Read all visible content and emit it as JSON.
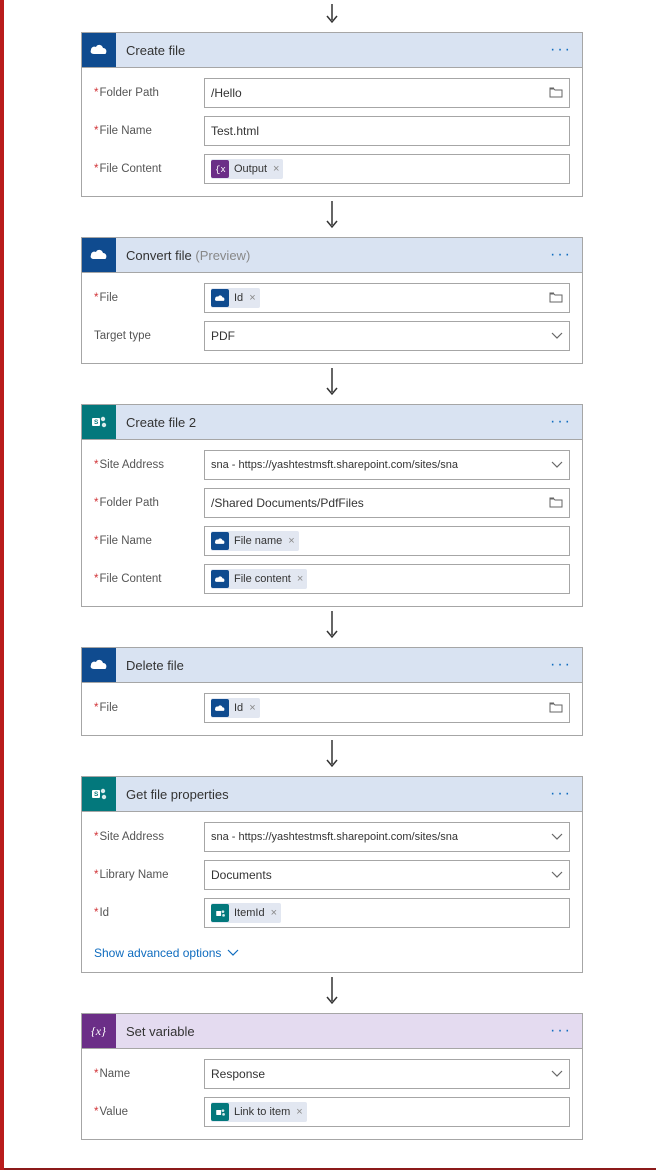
{
  "steps": [
    {
      "title": "Create file",
      "fields": {
        "folderPath": {
          "label": "Folder Path",
          "value": "/Hello"
        },
        "fileName": {
          "label": "File Name",
          "value": "Test.html"
        },
        "fileContent": {
          "label": "File Content",
          "token": "Output"
        }
      }
    },
    {
      "title": "Convert file",
      "preview": "(Preview)",
      "fields": {
        "file": {
          "label": "File",
          "token": "Id"
        },
        "targetType": {
          "label": "Target type",
          "value": "PDF"
        }
      }
    },
    {
      "title": "Create file 2",
      "fields": {
        "siteAddress": {
          "label": "Site Address",
          "value": "sna - https://yashtestmsft.sharepoint.com/sites/sna"
        },
        "folderPath": {
          "label": "Folder Path",
          "value": "/Shared Documents/PdfFiles"
        },
        "fileName": {
          "label": "File Name",
          "token": "File name"
        },
        "fileContent": {
          "label": "File Content",
          "token": "File content"
        }
      }
    },
    {
      "title": "Delete file",
      "fields": {
        "file": {
          "label": "File",
          "token": "Id"
        }
      }
    },
    {
      "title": "Get file properties",
      "fields": {
        "siteAddress": {
          "label": "Site Address",
          "value": "sna - https://yashtestmsft.sharepoint.com/sites/sna"
        },
        "libraryName": {
          "label": "Library Name",
          "value": "Documents"
        },
        "id": {
          "label": "Id",
          "token": "ItemId"
        }
      },
      "advanced": "Show advanced options"
    },
    {
      "title": "Set variable",
      "fields": {
        "name": {
          "label": "Name",
          "value": "Response"
        },
        "value": {
          "label": "Value",
          "token": "Link to item"
        }
      }
    }
  ]
}
